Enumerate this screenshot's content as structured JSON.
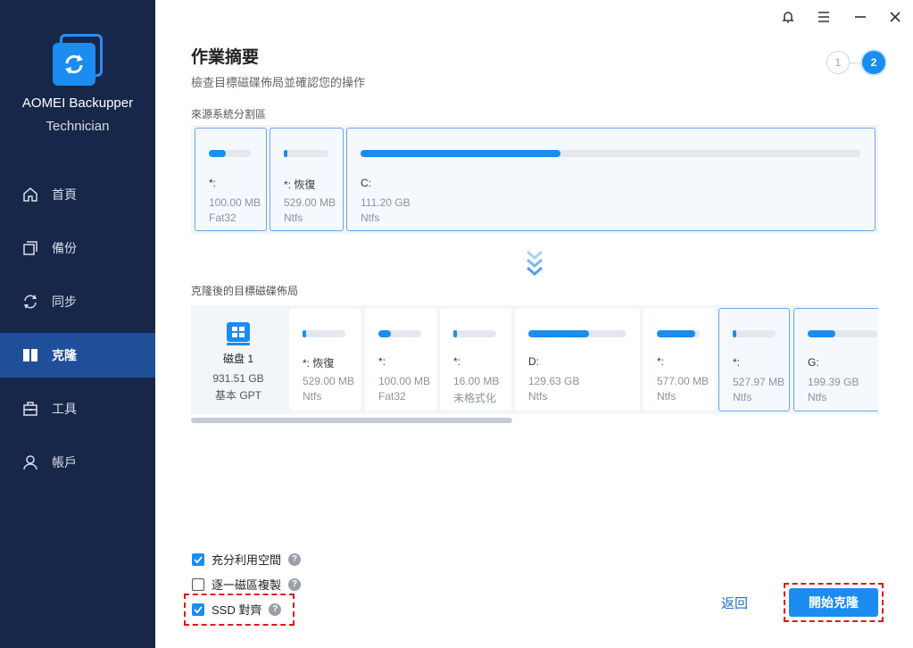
{
  "app": {
    "name": "AOMEI Backupper",
    "edition": "Technician"
  },
  "sidebar": {
    "items": [
      {
        "label": "首頁",
        "icon": "home-icon"
      },
      {
        "label": "備份",
        "icon": "backup-icon"
      },
      {
        "label": "同步",
        "icon": "sync-icon"
      },
      {
        "label": "克隆",
        "icon": "clone-icon",
        "active": true
      },
      {
        "label": "工具",
        "icon": "toolbox-icon"
      },
      {
        "label": "帳戶",
        "icon": "user-icon"
      }
    ]
  },
  "header": {
    "title": "作業摘要",
    "subtitle": "檢查目標磁碟佈局並確認您的操作",
    "steps": [
      "1",
      "2"
    ]
  },
  "source": {
    "label": "來源系統分割區",
    "partitions": [
      {
        "label": "*:",
        "size": "100.00 MB",
        "fs": "Fat32",
        "fill": 0.4
      },
      {
        "label": "*: 恢復",
        "size": "529.00 MB",
        "fs": "Ntfs",
        "fill": 0.08
      },
      {
        "label": "C:",
        "size": "111.20 GB",
        "fs": "Ntfs",
        "fill": 0.4
      }
    ]
  },
  "target": {
    "label": "克隆後的目標磁碟佈局",
    "disk": {
      "name": "磁盘 1",
      "size": "931.51 GB",
      "type": "基本 GPT"
    },
    "partitions": [
      {
        "label": "*: 恢復",
        "size": "529.00 MB",
        "fs": "Ntfs",
        "fill": 0.08
      },
      {
        "label": "*:",
        "size": "100.00 MB",
        "fs": "Fat32",
        "fill": 0.3
      },
      {
        "label": "*:",
        "size": "16.00 MB",
        "fs": "未格式化",
        "fill": 0.08
      },
      {
        "label": "D:",
        "size": "129.63 GB",
        "fs": "Ntfs",
        "fill": 0.62
      },
      {
        "label": "*:",
        "size": "577.00 MB",
        "fs": "Ntfs",
        "fill": 0.9
      },
      {
        "label": "*:",
        "size": "527.97 MB",
        "fs": "Ntfs",
        "fill": 0.08
      },
      {
        "label": "G:",
        "size": "199.39 GB",
        "fs": "Ntfs",
        "fill": 0.4
      }
    ]
  },
  "options": {
    "make_full_use": "充分利用空間",
    "sector_by_sector": "逐一磁區複製",
    "ssd_align": "SSD 對齊",
    "help": "?"
  },
  "buttons": {
    "back": "返回",
    "start": "開始克隆"
  },
  "colors": {
    "sidebar": "#17274a",
    "accent": "#1b8cf0",
    "highlight": "#e0161b"
  }
}
